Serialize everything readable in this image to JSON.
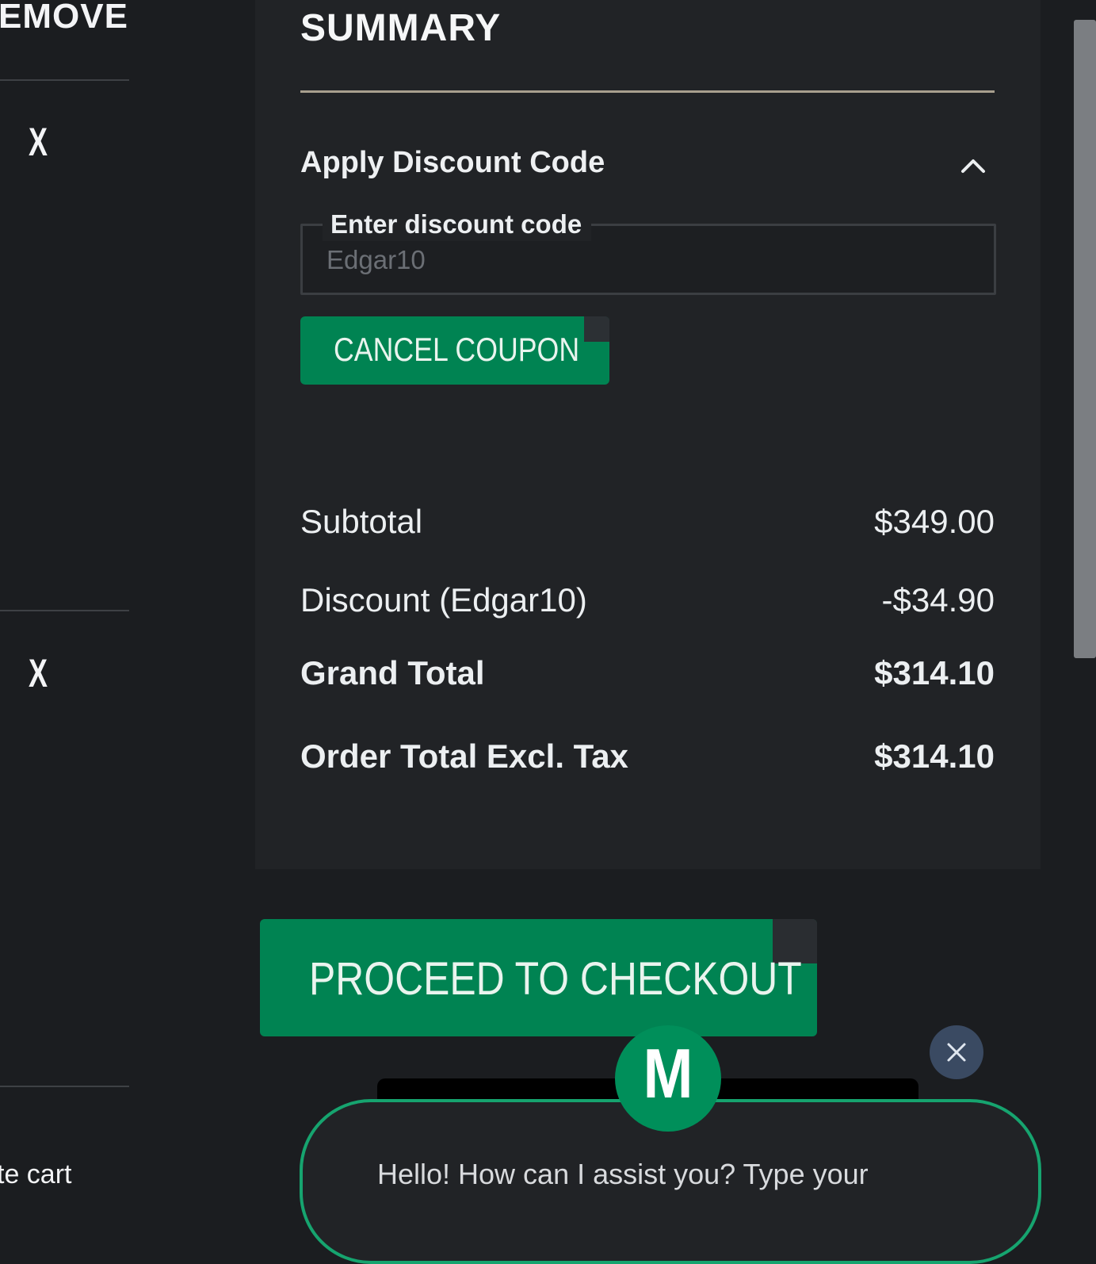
{
  "cart_column": {
    "remove_header": "EMOVE",
    "remove_item_1": "X",
    "remove_item_2": "X",
    "update_cart_link": "te cart"
  },
  "summary": {
    "title": "SUMMARY",
    "discount": {
      "toggle_label": "Apply Discount Code",
      "toggle_icon": "chevron-up-icon",
      "field_label": "Enter discount code",
      "field_value": "Edgar10",
      "cancel_button": "CANCEL COUPON"
    },
    "totals": {
      "subtotal_label": "Subtotal",
      "subtotal_value": "$349.00",
      "discount_label": "Discount (Edgar10)",
      "discount_value": "-$34.90",
      "grand_total_label": "Grand Total",
      "grand_total_value": "$314.10",
      "excl_tax_label": "Order Total Excl. Tax",
      "excl_tax_value": "$314.10"
    }
  },
  "checkout_button": "PROCEED TO CHECKOUT",
  "chat_widget": {
    "avatar_letter": "M",
    "greeting": "Hello! How can I assist you? Type your",
    "close_icon": "close-icon"
  },
  "colors": {
    "background": "#1b1d20",
    "panel": "#212326",
    "accent_green": "#008352",
    "chat_border": "#16a46f"
  }
}
